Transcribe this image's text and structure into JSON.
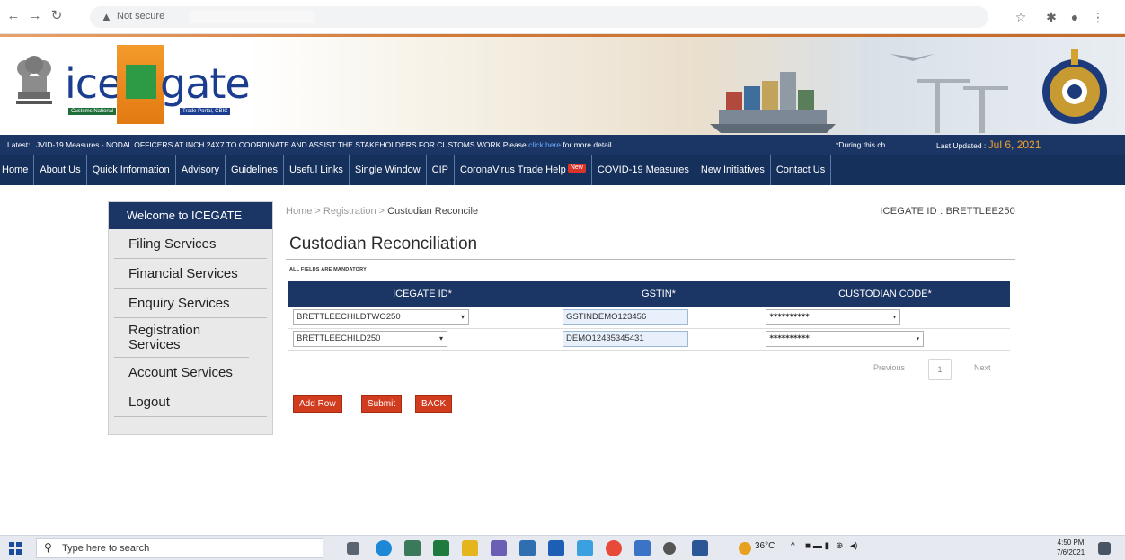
{
  "browser": {
    "security_label": "Not secure",
    "icons": [
      "back-arrow",
      "forward-arrow",
      "reload",
      "warning",
      "star",
      "extension",
      "profile",
      "menu-dots"
    ]
  },
  "header": {
    "logo_ice": "ice",
    "logo_gate": "gate",
    "logo_sub_left": "Customs National",
    "logo_sub_right": "Trade Portal, CBIC"
  },
  "ticker": {
    "label": "Latest:",
    "message": "JVID-19 Measures - NODAL OFFICERS AT INCH 24X7 TO COORDINATE AND ASSIST THE STAKEHOLDERS FOR CUSTOMS WORK.Please",
    "link_text": "click here",
    "more": "for more detail.",
    "during": "*During this ch",
    "last_updated_label": "Last Updated :",
    "last_updated_date": "Jul 6, 2021"
  },
  "mainnav": {
    "items": [
      "Home",
      "About Us",
      "Quick Information",
      "Advisory",
      "Guidelines",
      "Useful Links",
      "Single Window",
      "CIP",
      "CoronaVirus Trade Help",
      "COVID-19 Measures",
      "New Initiatives",
      "Contact Us"
    ],
    "new_badge": "New"
  },
  "sidebar": {
    "heading": "Welcome to ICEGATE",
    "items": [
      "Filing Services",
      "Financial Services",
      "Enquiry Services",
      "Registration Services",
      "Account Services",
      "Logout"
    ]
  },
  "content": {
    "breadcrumb": {
      "home": "Home",
      "registration": "Registration",
      "current": "Custodian Reconcile",
      "separator": ">"
    },
    "icegate_id": "ICEGATE ID : BRETTLEE250",
    "title": "Custodian Reconciliation",
    "mandatory": "ALL FIELDS ARE MANDATORY",
    "table": {
      "headers": [
        "ICEGATE ID*",
        "GSTIN*",
        "CUSTODIAN CODE*"
      ],
      "rows": [
        {
          "icegate_id": "BRETTLEECHILDTWO250",
          "gstin": "GSTINDEMO123456",
          "custodian_code": "**********"
        },
        {
          "icegate_id": "BRETTLEECHILD250",
          "gstin": "DEMO12435345431",
          "custodian_code": "**********"
        }
      ]
    },
    "pagination": {
      "previous": "Previous",
      "page": "1",
      "next": "Next"
    },
    "buttons": {
      "add_row": "Add Row",
      "submit": "Submit",
      "back": "BACK"
    }
  },
  "taskbar": {
    "search_placeholder": "Type here to search",
    "temperature": "36°C",
    "time": "4:50 PM",
    "date": "7/6/2021"
  }
}
